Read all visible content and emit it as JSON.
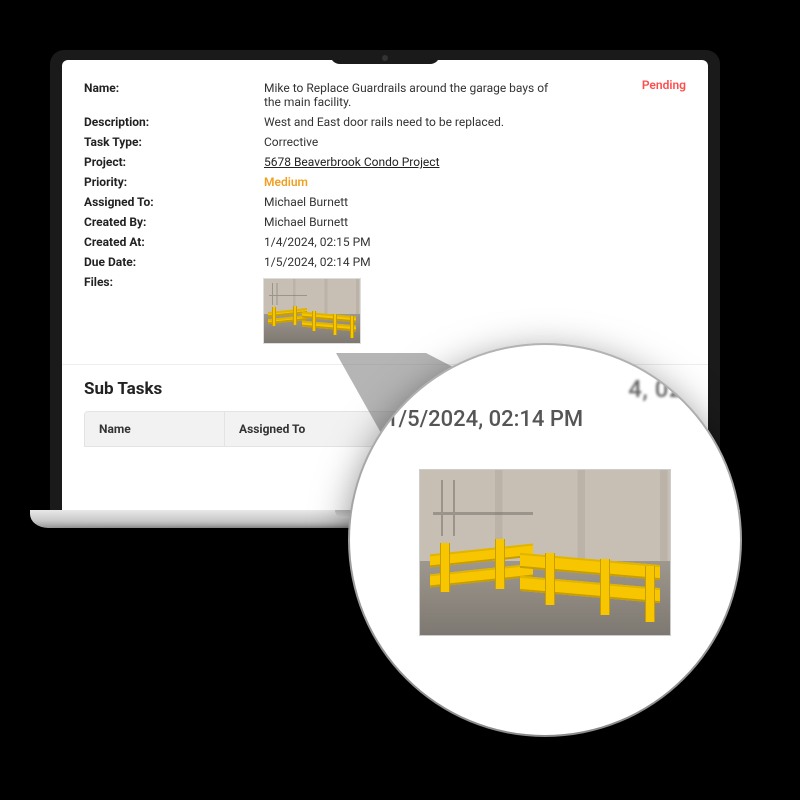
{
  "status": "Pending",
  "fields": {
    "name": {
      "label": "Name:",
      "value": "Mike to Replace Guardrails around the garage bays of the main facility."
    },
    "description": {
      "label": "Description:",
      "value": "West and East door rails need to be replaced."
    },
    "task_type": {
      "label": "Task Type:",
      "value": "Corrective"
    },
    "project": {
      "label": "Project:",
      "value": "5678 Beaverbrook Condo Project"
    },
    "priority": {
      "label": "Priority:",
      "value": "Medium"
    },
    "assigned_to": {
      "label": "Assigned To:",
      "value": "Michael Burnett"
    },
    "created_by": {
      "label": "Created By:",
      "value": "Michael Burnett"
    },
    "created_at": {
      "label": "Created At:",
      "value": "1/4/2024, 02:15 PM"
    },
    "due_date": {
      "label": "Due Date:",
      "value": "1/5/2024, 02:14 PM"
    },
    "files": {
      "label": "Files:"
    }
  },
  "subtasks": {
    "title": "Sub Tasks",
    "columns": {
      "name": "Name",
      "assigned_to": "Assigned To"
    }
  },
  "magnifier": {
    "line1_fragment": "4, 02:1",
    "line2": "1/5/2024, 02:14 PM"
  }
}
